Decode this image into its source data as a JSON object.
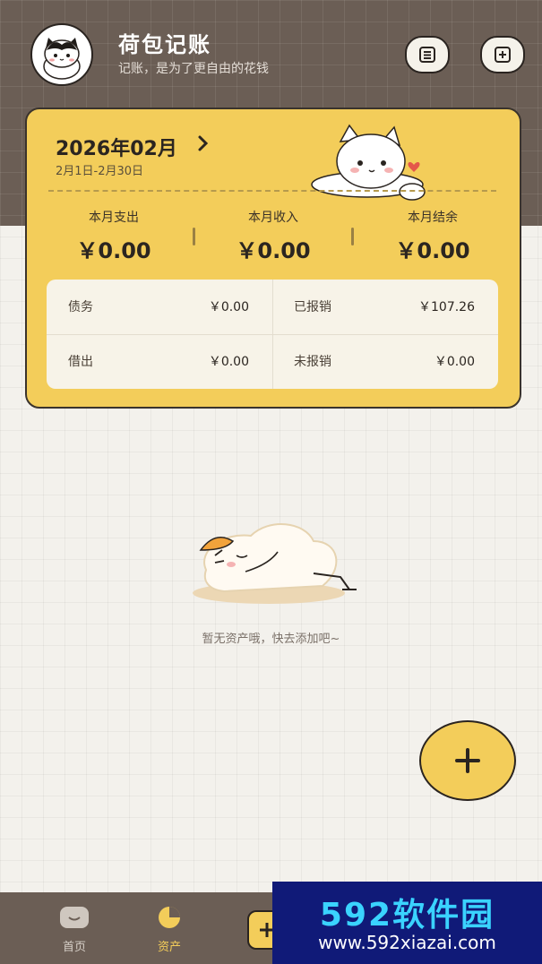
{
  "header": {
    "title": "荷包记账",
    "subtitle": "记账，是为了更自由的花钱",
    "icons": [
      "list-icon",
      "add-box-icon"
    ]
  },
  "card": {
    "period": "2026年02月",
    "range": "2月1日-2月30日",
    "stats": [
      {
        "label": "本月支出",
        "value": "￥0.00"
      },
      {
        "label": "本月收入",
        "value": "￥0.00"
      },
      {
        "label": "本月结余",
        "value": "￥0.00"
      }
    ],
    "items": [
      {
        "label": "债务",
        "value": "￥0.00"
      },
      {
        "label": "已报销",
        "value": "￥107.26"
      },
      {
        "label": "借出",
        "value": "￥0.00"
      },
      {
        "label": "未报销",
        "value": "￥0.00"
      }
    ]
  },
  "empty": {
    "text": "暂无资产哦，快去添加吧~"
  },
  "nav": {
    "items": [
      {
        "label": "首页",
        "icon": "home-icon"
      },
      {
        "label": "资产",
        "icon": "pie-chart-icon"
      }
    ]
  },
  "watermark": {
    "brand": "592软件园",
    "url": "www.592xiazai.com"
  },
  "colors": {
    "accent": "#f3cd5a",
    "header_bg": "#6b5e55",
    "page_bg": "#f3f1ec"
  }
}
